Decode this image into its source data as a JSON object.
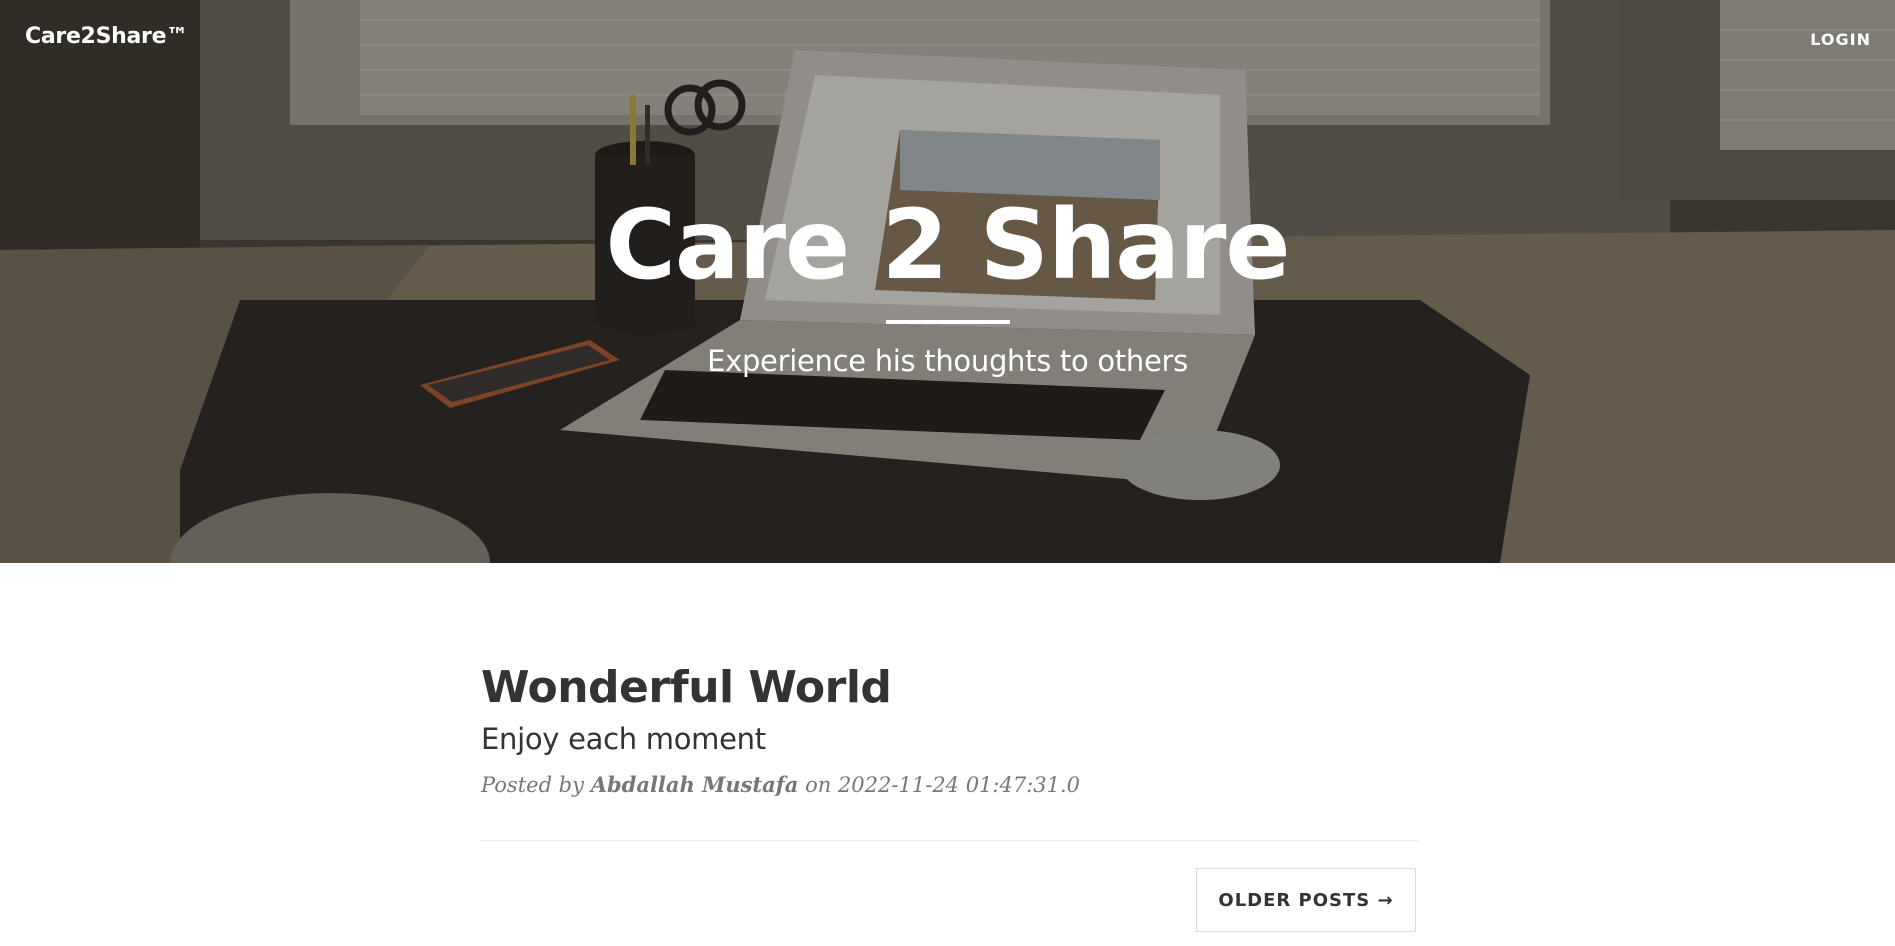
{
  "navbar": {
    "brand": "Care2Share™",
    "login_label": "LOGIN"
  },
  "hero": {
    "title": "Care 2 Share",
    "subtitle": "Experience his thoughts to others",
    "background_image": "desk-laptop-photo"
  },
  "posts": [
    {
      "title": "Wonderful World",
      "subtitle": "Enjoy each moment",
      "meta_prefix": "Posted by",
      "author": "Abdallah Mustafa",
      "meta_on": "on",
      "date": "2022-11-24 01:47:31.0"
    }
  ],
  "pager": {
    "older_label": "OLDER POSTS →"
  },
  "colors": {
    "text_dark": "#333333",
    "text_meta": "#777777",
    "hero_overlay": "#1e1a16"
  }
}
